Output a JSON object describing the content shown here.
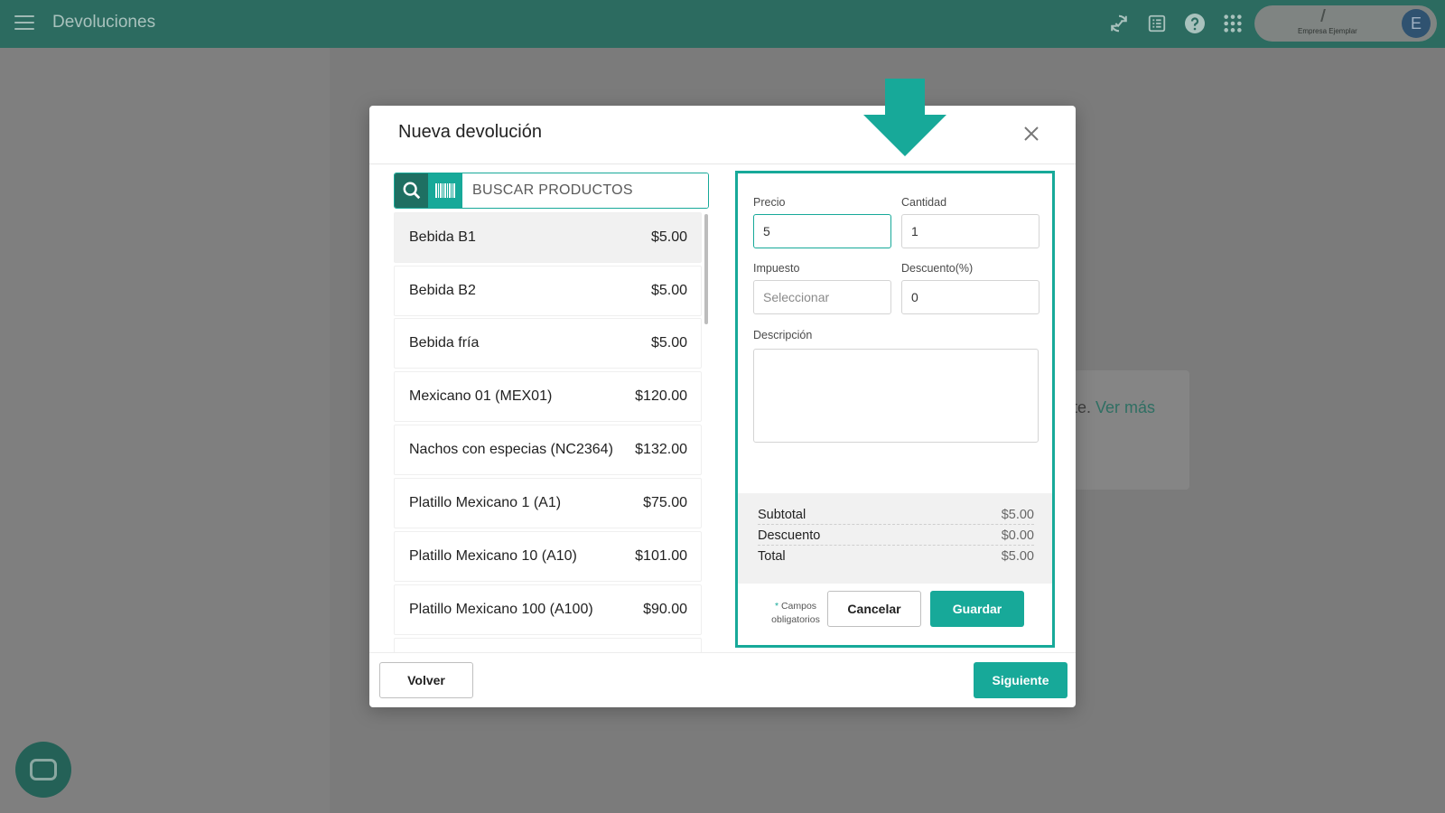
{
  "header": {
    "title": "Devoluciones",
    "icons": [
      "sync-check-icon",
      "receipt-list-icon",
      "help-icon",
      "apps-grid-icon"
    ],
    "company_name": "Empresa Ejemplar",
    "avatar_initial": "E"
  },
  "background": {
    "text_fragment": "te.",
    "link": "Ver más"
  },
  "modal": {
    "title": "Nueva devolución",
    "search": {
      "placeholder": "BUSCAR PRODUCTOS"
    },
    "products": [
      {
        "name": "Bebida B1",
        "price": "$5.00"
      },
      {
        "name": "Bebida B2",
        "price": "$5.00"
      },
      {
        "name": "Bebida fría",
        "price": "$5.00"
      },
      {
        "name": "Mexicano 01 (MEX01)",
        "price": "$120.00"
      },
      {
        "name": "Nachos con especias (NC2364)",
        "price": "$132.00"
      },
      {
        "name": "Platillo Mexicano 1 (A1)",
        "price": "$75.00"
      },
      {
        "name": "Platillo Mexicano 10 (A10)",
        "price": "$101.00"
      },
      {
        "name": "Platillo Mexicano 100 (A100)",
        "price": "$90.00"
      }
    ],
    "form": {
      "precio_label": "Precio",
      "precio_value": "5",
      "cantidad_label": "Cantidad",
      "cantidad_value": "1",
      "impuesto_label": "Impuesto",
      "impuesto_placeholder": "Seleccionar",
      "descuento_label": "Descuento(%)",
      "descuento_value": "0",
      "descripcion_label": "Descripción"
    },
    "totals": {
      "subtotal_label": "Subtotal",
      "subtotal_value": "$5.00",
      "descuento_label": "Descuento",
      "descuento_value": "$0.00",
      "total_label": "Total",
      "total_value": "$5.00"
    },
    "required_note_star": "*",
    "required_note": "Campos obligatorios",
    "cancel_label": "Cancelar",
    "save_label": "Guardar",
    "back_label": "Volver",
    "next_label": "Siguiente"
  },
  "colors": {
    "topbar": "#2c6b60",
    "accent": "#17a999",
    "accent_dark": "#1e6f62"
  }
}
